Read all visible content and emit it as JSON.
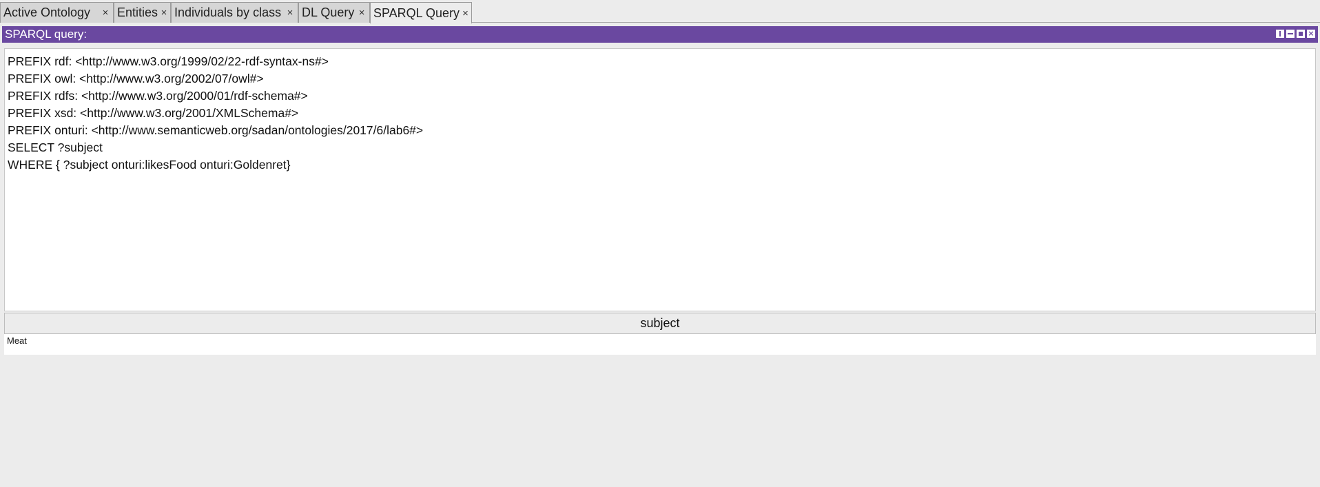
{
  "tabs": [
    {
      "label": "Active Ontology",
      "close": "×"
    },
    {
      "label": "Entities",
      "close": "×"
    },
    {
      "label": "Individuals by class",
      "close": "×"
    },
    {
      "label": "DL Query",
      "close": "×"
    },
    {
      "label": "SPARQL Query",
      "close": "×"
    }
  ],
  "active_tab": "SPARQL Query",
  "view": {
    "title": "SPARQL query:",
    "header_color": "#6a48a0",
    "controls": [
      "split-icon",
      "minimize-icon",
      "maximize-icon",
      "close-icon"
    ],
    "close_glyph": "×"
  },
  "query": {
    "lines": [
      "PREFIX rdf: <http://www.w3.org/1999/02/22-rdf-syntax-ns#>",
      "PREFIX owl: <http://www.w3.org/2002/07/owl#>",
      "PREFIX rdfs: <http://www.w3.org/2000/01/rdf-schema#>",
      "PREFIX xsd: <http://www.w3.org/2001/XMLSchema#>",
      "PREFIX onturi: <http://www.semanticweb.org/sadan/ontologies/2017/6/lab6#>",
      "SELECT ?subject",
      "WHERE { ?subject onturi:likesFood onturi:Goldenret}"
    ]
  },
  "results": {
    "columns": [
      "subject"
    ],
    "rows": [
      [
        "Meat"
      ]
    ]
  }
}
